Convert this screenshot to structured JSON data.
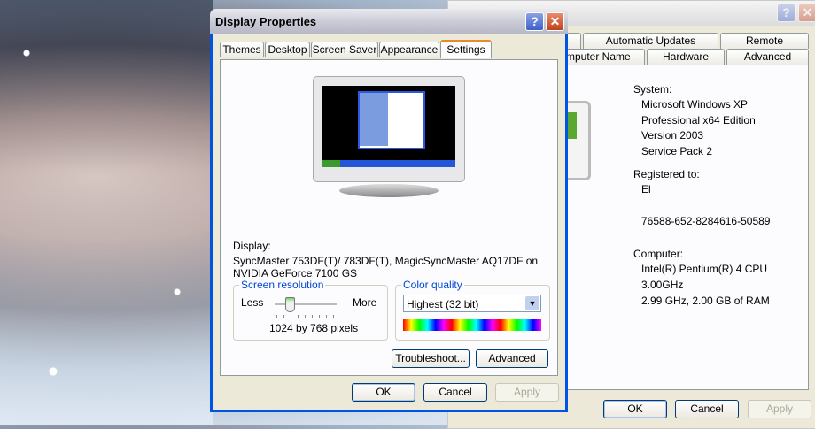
{
  "back_window": {
    "tabs_row1": [
      "Automatic Updates",
      "Remote"
    ],
    "tabs_row2": [
      "mputer Name",
      "Hardware",
      "Advanced"
    ],
    "system_label": "System:",
    "system_lines": [
      "Microsoft Windows XP",
      "Professional x64 Edition",
      "Version 2003",
      "Service Pack 2"
    ],
    "registered_label": "Registered to:",
    "registered_lines": [
      "El",
      "",
      "76588-652-8284616-50589"
    ],
    "computer_label": "Computer:",
    "computer_lines": [
      "Intel(R) Pentium(R) 4 CPU",
      "3.00GHz",
      "2.99 GHz, 2.00 GB of RAM"
    ],
    "ok": "OK",
    "cancel": "Cancel",
    "apply": "Apply",
    "help": "?",
    "close": "✕"
  },
  "dialog": {
    "title": "Display Properties",
    "help": "?",
    "close": "✕",
    "tabs": [
      "Themes",
      "Desktop",
      "Screen Saver",
      "Appearance",
      "Settings"
    ],
    "selected_tab": "Settings",
    "display_label": "Display:",
    "display_value": "SyncMaster 753DF(T)/ 783DF(T), MagicSyncMaster AQ17DF on NVIDIA GeForce 7100 GS",
    "resolution": {
      "legend": "Screen resolution",
      "less": "Less",
      "more": "More",
      "value": "1024 by 768 pixels",
      "slider_position": 0.25
    },
    "color": {
      "legend": "Color quality",
      "selected": "Highest (32 bit)"
    },
    "troubleshoot": "Troubleshoot...",
    "advanced": "Advanced",
    "ok": "OK",
    "cancel": "Cancel",
    "apply": "Apply"
  }
}
